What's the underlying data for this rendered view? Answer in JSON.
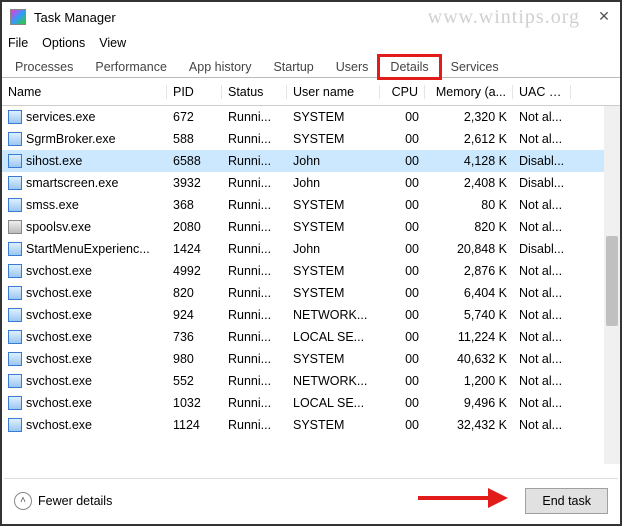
{
  "window": {
    "title": "Task Manager",
    "watermark": "www.wintips.org"
  },
  "menubar": [
    "File",
    "Options",
    "View"
  ],
  "tabs": [
    {
      "label": "Processes",
      "active": false
    },
    {
      "label": "Performance",
      "active": false
    },
    {
      "label": "App history",
      "active": false
    },
    {
      "label": "Startup",
      "active": false
    },
    {
      "label": "Users",
      "active": false
    },
    {
      "label": "Details",
      "active": true,
      "highlight": true
    },
    {
      "label": "Services",
      "active": false
    }
  ],
  "columns": [
    "Name",
    "PID",
    "Status",
    "User name",
    "CPU",
    "Memory (a...",
    "UAC vi..."
  ],
  "rows": [
    {
      "icon": "app",
      "name": "services.exe",
      "pid": "672",
      "status": "Runni...",
      "user": "SYSTEM",
      "cpu": "00",
      "mem": "2,320 K",
      "uac": "Not al...",
      "selected": false
    },
    {
      "icon": "app",
      "name": "SgrmBroker.exe",
      "pid": "588",
      "status": "Runni...",
      "user": "SYSTEM",
      "cpu": "00",
      "mem": "2,612 K",
      "uac": "Not al...",
      "selected": false
    },
    {
      "icon": "app",
      "name": "sihost.exe",
      "pid": "6588",
      "status": "Runni...",
      "user": "John",
      "cpu": "00",
      "mem": "4,128 K",
      "uac": "Disabl...",
      "selected": true
    },
    {
      "icon": "app",
      "name": "smartscreen.exe",
      "pid": "3932",
      "status": "Runni...",
      "user": "John",
      "cpu": "00",
      "mem": "2,408 K",
      "uac": "Disabl...",
      "selected": false
    },
    {
      "icon": "app",
      "name": "smss.exe",
      "pid": "368",
      "status": "Runni...",
      "user": "SYSTEM",
      "cpu": "00",
      "mem": "80 K",
      "uac": "Not al...",
      "selected": false
    },
    {
      "icon": "printer",
      "name": "spoolsv.exe",
      "pid": "2080",
      "status": "Runni...",
      "user": "SYSTEM",
      "cpu": "00",
      "mem": "820 K",
      "uac": "Not al...",
      "selected": false
    },
    {
      "icon": "app",
      "name": "StartMenuExperienc...",
      "pid": "1424",
      "status": "Runni...",
      "user": "John",
      "cpu": "00",
      "mem": "20,848 K",
      "uac": "Disabl...",
      "selected": false
    },
    {
      "icon": "app",
      "name": "svchost.exe",
      "pid": "4992",
      "status": "Runni...",
      "user": "SYSTEM",
      "cpu": "00",
      "mem": "2,876 K",
      "uac": "Not al...",
      "selected": false
    },
    {
      "icon": "app",
      "name": "svchost.exe",
      "pid": "820",
      "status": "Runni...",
      "user": "SYSTEM",
      "cpu": "00",
      "mem": "6,404 K",
      "uac": "Not al...",
      "selected": false
    },
    {
      "icon": "app",
      "name": "svchost.exe",
      "pid": "924",
      "status": "Runni...",
      "user": "NETWORK...",
      "cpu": "00",
      "mem": "5,740 K",
      "uac": "Not al...",
      "selected": false
    },
    {
      "icon": "app",
      "name": "svchost.exe",
      "pid": "736",
      "status": "Runni...",
      "user": "LOCAL SE...",
      "cpu": "00",
      "mem": "11,224 K",
      "uac": "Not al...",
      "selected": false
    },
    {
      "icon": "app",
      "name": "svchost.exe",
      "pid": "980",
      "status": "Runni...",
      "user": "SYSTEM",
      "cpu": "00",
      "mem": "40,632 K",
      "uac": "Not al...",
      "selected": false
    },
    {
      "icon": "app",
      "name": "svchost.exe",
      "pid": "552",
      "status": "Runni...",
      "user": "NETWORK...",
      "cpu": "00",
      "mem": "1,200 K",
      "uac": "Not al...",
      "selected": false
    },
    {
      "icon": "app",
      "name": "svchost.exe",
      "pid": "1032",
      "status": "Runni...",
      "user": "LOCAL SE...",
      "cpu": "00",
      "mem": "9,496 K",
      "uac": "Not al...",
      "selected": false
    },
    {
      "icon": "app",
      "name": "svchost.exe",
      "pid": "1124",
      "status": "Runni...",
      "user": "SYSTEM",
      "cpu": "00",
      "mem": "32,432 K",
      "uac": "Not al...",
      "selected": false
    }
  ],
  "footer": {
    "fewer_label": "Fewer details",
    "end_task_label": "End task"
  }
}
